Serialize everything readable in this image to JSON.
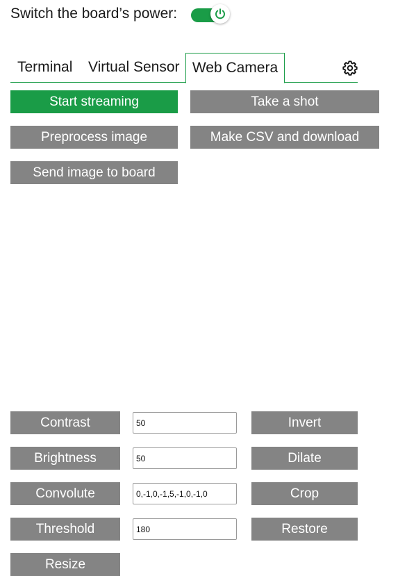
{
  "power": {
    "label": "Switch the board’s power:",
    "state": "on",
    "accent": "#1a9c47"
  },
  "tabs": [
    {
      "label": "Terminal",
      "active": false
    },
    {
      "label": "Virtual Sensor",
      "active": false
    },
    {
      "label": "Web Camera",
      "active": true
    }
  ],
  "settings_icon": "gear-icon",
  "camera_actions": {
    "start_streaming": "Start streaming",
    "take_shot": "Take a shot",
    "preprocess": "Preprocess image",
    "make_csv": "Make CSV and download",
    "send_image": "Send image to board"
  },
  "image_ops": {
    "contrast": {
      "label": "Contrast",
      "value": "50"
    },
    "brightness": {
      "label": "Brightness",
      "value": "50"
    },
    "convolute": {
      "label": "Convolute",
      "value": "0,-1,0,-1,5,-1,0,-1,0"
    },
    "threshold": {
      "label": "Threshold",
      "value": "180"
    },
    "resize": {
      "label": "Resize"
    },
    "invert": {
      "label": "Invert"
    },
    "dilate": {
      "label": "Dilate"
    },
    "crop": {
      "label": "Crop"
    },
    "restore": {
      "label": "Restore"
    }
  },
  "colors": {
    "primary_green": "#1a9c47",
    "button_gray": "#848484"
  }
}
